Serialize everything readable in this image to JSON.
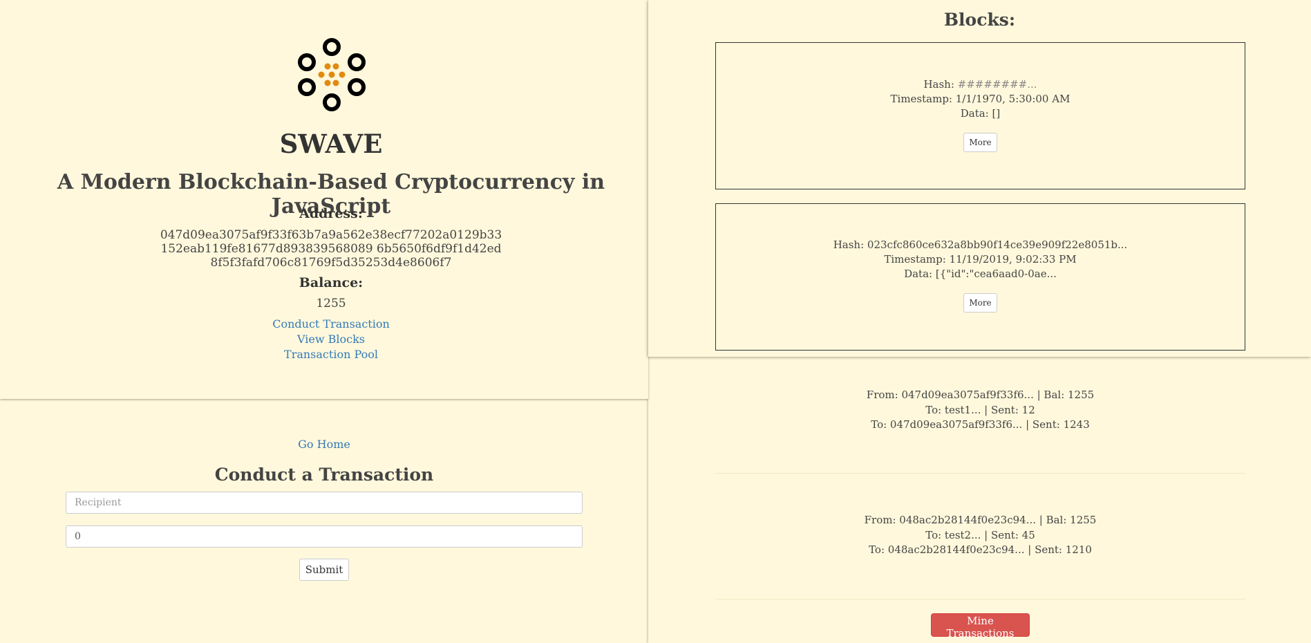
{
  "home": {
    "title": "SWAVE",
    "subtitle": "A Modern Blockchain-Based Cryptocurrency in JavaScript",
    "address_label": "Address:",
    "address": "047d09ea3075af9f33f63b7a9a562e38ecf77202a0129b33152eab119fe81677d893839568089 6b5650f6df9f1d42ed8f5f3fafd706c81769f5d35253d4e8606f7",
    "balance_label": "Balance:",
    "balance": "1255",
    "links": [
      "Conduct Transaction",
      "View Blocks",
      "Transaction Pool"
    ],
    "logo_icon": "swave-logo-icon",
    "accent_color": "#e08a10"
  },
  "transaction": {
    "go_home": "Go Home",
    "title": "Conduct a Transaction",
    "recipient_placeholder": "Recipient",
    "amount_value": "0",
    "submit_label": "Submit"
  },
  "blocks": {
    "title": "Blocks:",
    "items": [
      {
        "hash_label": "Hash:",
        "hash": "########...",
        "timestamp": "Timestamp: 1/1/1970, 5:30:00 AM",
        "data": "Data: []",
        "more_label": "More"
      },
      {
        "hash_label": "Hash:",
        "hash": "023cfc860ce632a8bb90f14ce39e909f22e8051b...",
        "timestamp": "Timestamp: 11/19/2019, 9:02:33 PM",
        "data": "Data: [{\"id\":\"cea6aad0-0ae...",
        "more_label": "More"
      }
    ]
  },
  "pool": {
    "items": [
      {
        "from": "From: 047d09ea3075af9f33f6... | Bal: 1255",
        "to1": "To: test1... | Sent: 12",
        "to2": "To: 047d09ea3075af9f33f6... | Sent: 1243"
      },
      {
        "from": "From: 048ac2b28144f0e23c94... | Bal: 1255",
        "to1": "To: test2... | Sent: 45",
        "to2": "To: 048ac2b28144f0e23c94... | Sent: 1210"
      }
    ],
    "mine_label": "Mine Transactions",
    "mine_color": "#d9534f"
  }
}
